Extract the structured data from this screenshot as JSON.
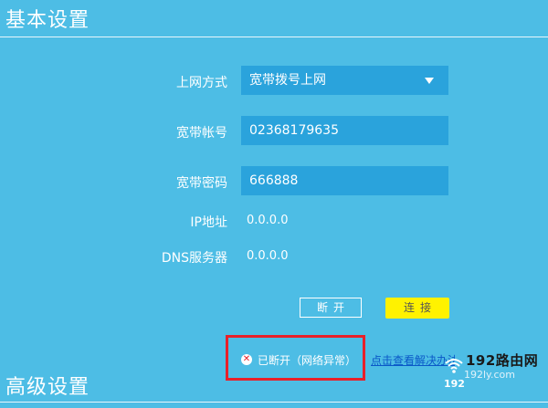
{
  "sections": {
    "basic_title": "基本设置",
    "advanced_title": "高级设置"
  },
  "form": {
    "connection_type": {
      "label": "上网方式",
      "value": "宽带拨号上网"
    },
    "account": {
      "label": "宽带帐号",
      "value": "02368179635"
    },
    "password": {
      "label": "宽带密码",
      "value": "666888"
    },
    "ip": {
      "label": "IP地址",
      "value": "0.0.0.0"
    },
    "dns": {
      "label": "DNS服务器",
      "value": "0.0.0.0"
    }
  },
  "buttons": {
    "disconnect": "断开",
    "connect": "连接"
  },
  "status": {
    "text": "已断开（网络异常）",
    "help_link": "点击查看解决办法",
    "icon": "error-x-icon",
    "highlight_color": "#e8202a"
  },
  "watermark": {
    "brand": "192路由网",
    "site": "192ly.com",
    "number": "192"
  },
  "colors": {
    "background": "#4dbde5",
    "field": "#2aa3dc",
    "connect_button": "#fff200",
    "link": "#0a58c8"
  }
}
